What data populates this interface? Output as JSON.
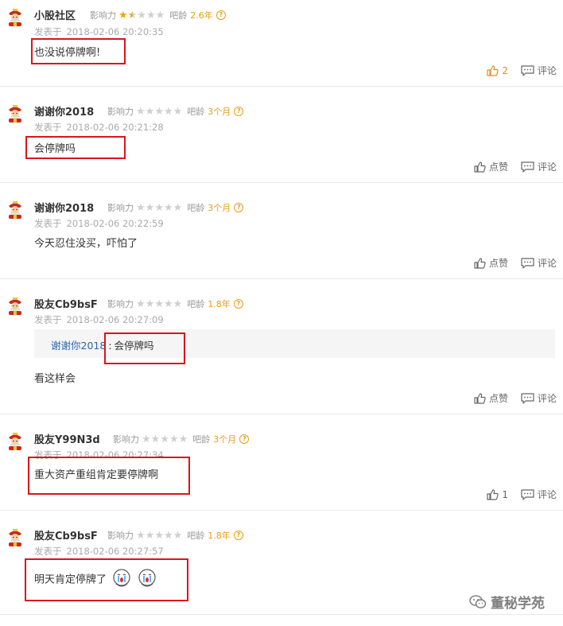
{
  "labels": {
    "influence": "影响力",
    "bar_age": "吧龄",
    "posted_at": "发表于",
    "like": "点赞",
    "comment": "评论"
  },
  "colors": {
    "highlight_box": "#d8161c",
    "accent": "#e79b1c",
    "username": "#333333",
    "link": "#2d64b3"
  },
  "posts": [
    {
      "username": "小股社区",
      "rating": 1.5,
      "max_rating": 5,
      "bar_age": "2.6年",
      "timestamp": "2018-02-06 20:20:35",
      "content": "也没说停牌啊!",
      "likes": "2",
      "liked": true
    },
    {
      "username": "谢谢你2018",
      "rating": 0,
      "max_rating": 5,
      "bar_age": "3个月",
      "timestamp": "2018-02-06 20:21:28",
      "content": "会停牌吗",
      "likes": "",
      "liked": false
    },
    {
      "username": "谢谢你2018",
      "rating": 0,
      "max_rating": 5,
      "bar_age": "3个月",
      "timestamp": "2018-02-06 20:22:59",
      "content": "今天忍住没买，吓怕了",
      "likes": "",
      "liked": false
    },
    {
      "username": "股友Cb9bsF",
      "rating": 0,
      "max_rating": 5,
      "bar_age": "1.8年",
      "timestamp": "2018-02-06 20:27:09",
      "quote": {
        "author": "谢谢你2018",
        "separator": ":",
        "text": "会停牌吗"
      },
      "content": "看这样会",
      "likes": "",
      "liked": false
    },
    {
      "username": "股友Y99N3d",
      "rating": 0,
      "max_rating": 5,
      "bar_age": "3个月",
      "timestamp": "2018-02-06 20:27:34",
      "content": "重大资产重组肯定要停牌啊",
      "likes": "1",
      "liked": false
    },
    {
      "username": "股友Cb9bsF",
      "rating": 0,
      "max_rating": 5,
      "bar_age": "1.8年",
      "timestamp": "2018-02-06 20:27:57",
      "content": "明天肯定停牌了",
      "emojis": [
        "crying-emoji",
        "crying-emoji"
      ],
      "likes": "",
      "liked": false
    }
  ],
  "watermark": {
    "text": "董秘学苑",
    "icon": "wechat-icon"
  }
}
